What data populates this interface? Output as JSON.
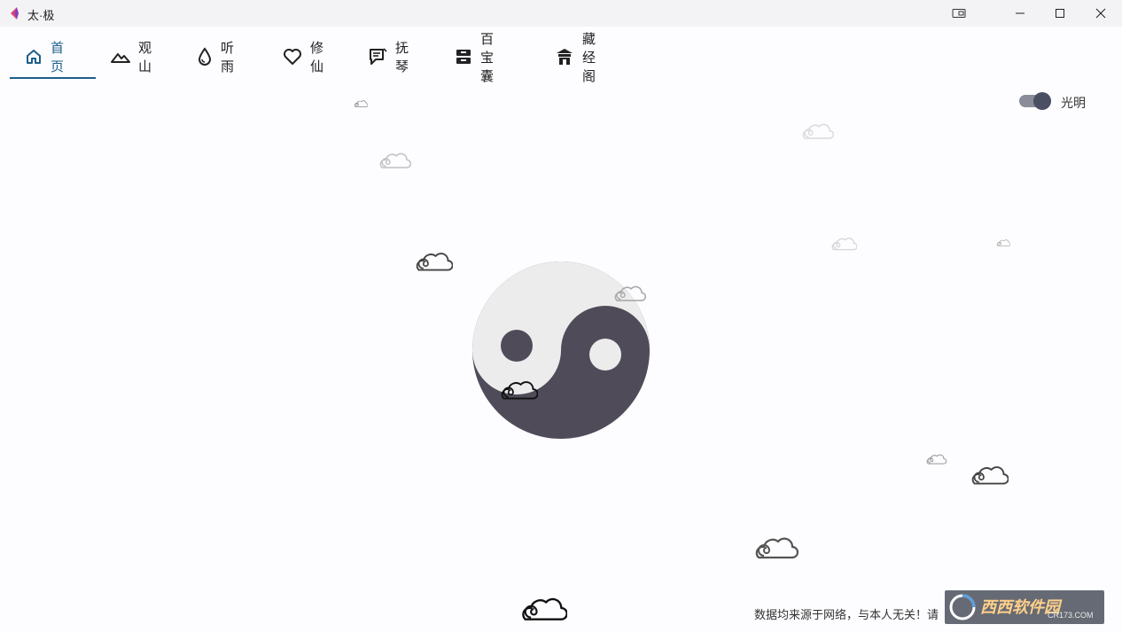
{
  "window": {
    "title": "太·极"
  },
  "nav": {
    "tabs": [
      {
        "label": "首页",
        "icon": "home-icon"
      },
      {
        "label": "观山",
        "icon": "mountain-icon"
      },
      {
        "label": "听雨",
        "icon": "drop-icon"
      },
      {
        "label": "修仙",
        "icon": "heart-icon"
      },
      {
        "label": "抚琴",
        "icon": "note-icon"
      },
      {
        "label": "百宝囊",
        "icon": "box-icon"
      },
      {
        "label": "藏经阁",
        "icon": "pavilion-icon"
      }
    ],
    "active_index": 0
  },
  "theme_toggle": {
    "label": "光明",
    "on": true
  },
  "footer": {
    "text": "数据均来源于网络，与本人无关！请"
  },
  "watermark": {
    "brand": "西西软件园",
    "site": "CR173.COM"
  },
  "colors": {
    "accent": "#1b5f8a",
    "dark": "#4f4b59",
    "light": "#ececec"
  }
}
